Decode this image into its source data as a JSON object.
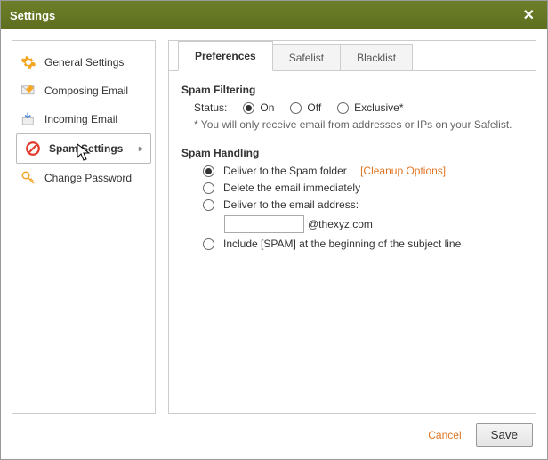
{
  "window": {
    "title": "Settings"
  },
  "sidebar": {
    "items": [
      {
        "label": "General Settings"
      },
      {
        "label": "Composing Email"
      },
      {
        "label": "Incoming Email"
      },
      {
        "label": "Spam Settings"
      },
      {
        "label": "Change Password"
      }
    ]
  },
  "tabs": {
    "preferences": "Preferences",
    "safelist": "Safelist",
    "blacklist": "Blacklist"
  },
  "spam_filtering": {
    "title": "Spam Filtering",
    "status_label": "Status:",
    "on": "On",
    "off": "Off",
    "exclusive": "Exclusive*",
    "note": "* You will only receive email from addresses or IPs on your Safelist."
  },
  "spam_handling": {
    "title": "Spam Handling",
    "deliver_spam_folder": "Deliver to the Spam folder",
    "cleanup_link": "[Cleanup Options]",
    "delete_immediately": "Delete the email immediately",
    "deliver_to_address": "Deliver to the email address:",
    "email_value": "",
    "email_domain": "@thexyz.com",
    "include_spam_tag": "Include [SPAM] at the beginning of the subject line"
  },
  "footer": {
    "cancel": "Cancel",
    "save": "Save"
  }
}
